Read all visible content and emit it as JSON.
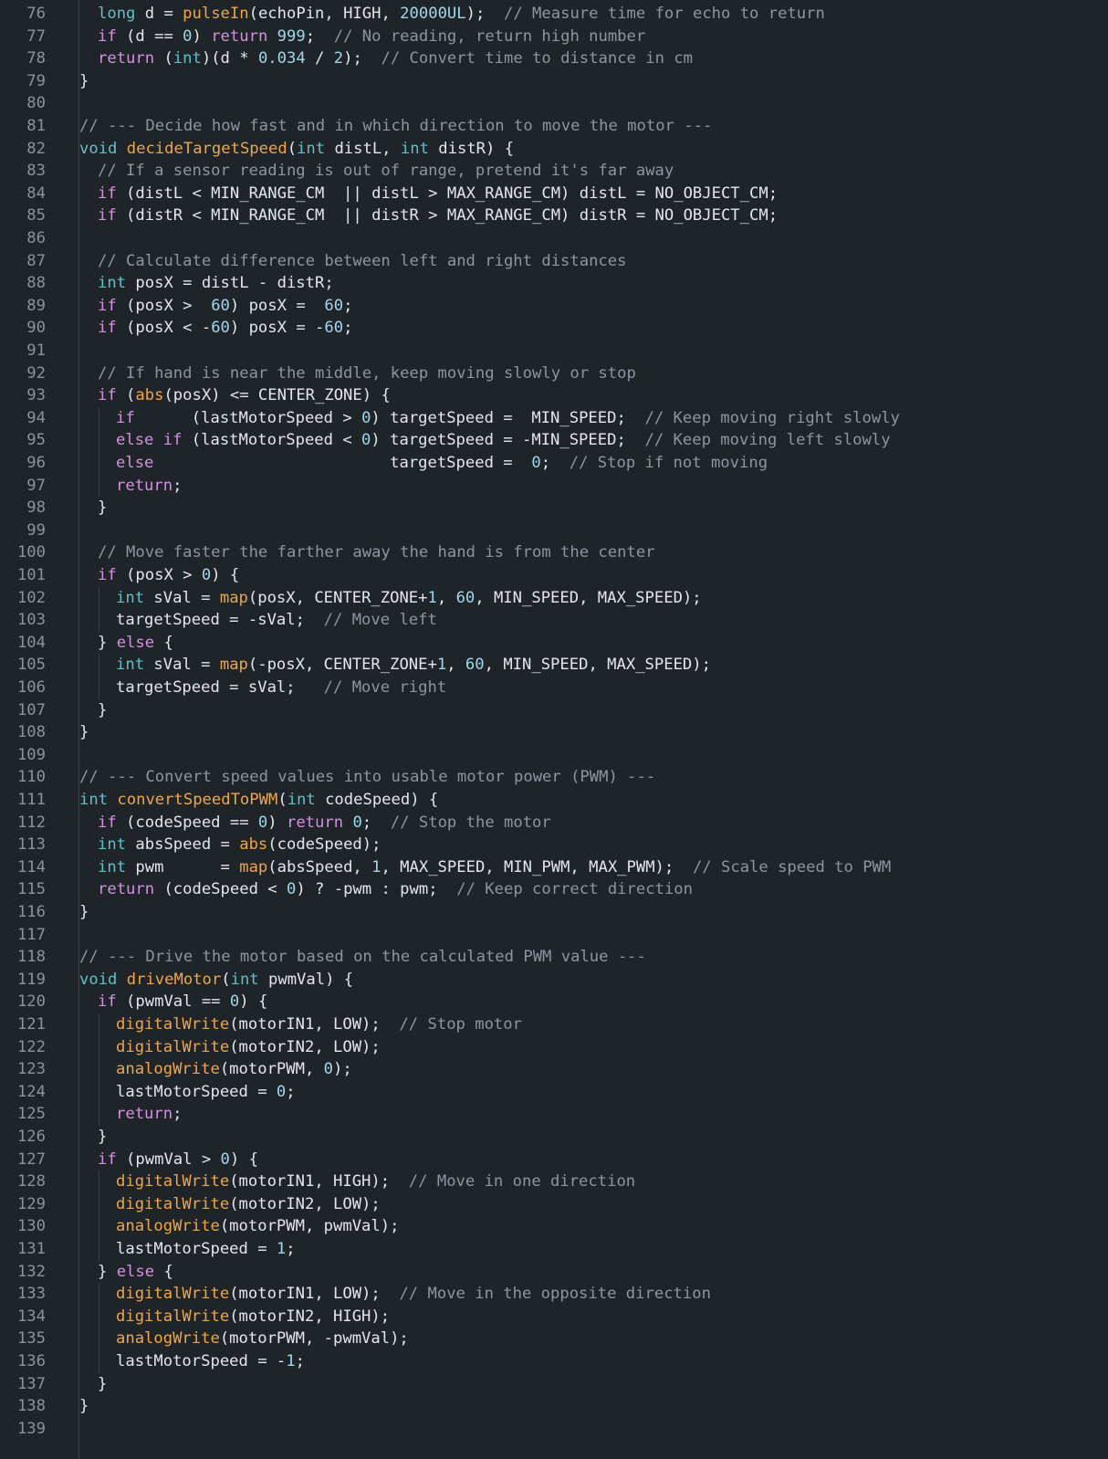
{
  "editor": {
    "first_line_number": 76,
    "lines": [
      {
        "indent": 1,
        "tokens": [
          [
            "t",
            "long"
          ],
          [
            "p",
            " d = "
          ],
          [
            "f",
            "pulseIn"
          ],
          [
            "p",
            "(echoPin, HIGH, "
          ],
          [
            "n",
            "20000UL"
          ],
          [
            "p",
            ");  "
          ],
          [
            "c",
            "// Measure time for echo to return"
          ]
        ]
      },
      {
        "indent": 1,
        "tokens": [
          [
            "k",
            "if"
          ],
          [
            "p",
            " (d == "
          ],
          [
            "n",
            "0"
          ],
          [
            "p",
            ") "
          ],
          [
            "k",
            "return"
          ],
          [
            "p",
            " "
          ],
          [
            "n",
            "999"
          ],
          [
            "p",
            ";  "
          ],
          [
            "c",
            "// No reading, return high number"
          ]
        ]
      },
      {
        "indent": 1,
        "tokens": [
          [
            "k",
            "return"
          ],
          [
            "p",
            " ("
          ],
          [
            "t",
            "int"
          ],
          [
            "p",
            ")(d * "
          ],
          [
            "n",
            "0.034"
          ],
          [
            "p",
            " / "
          ],
          [
            "n",
            "2"
          ],
          [
            "p",
            ");  "
          ],
          [
            "c",
            "// Convert time to distance in cm"
          ]
        ]
      },
      {
        "indent": 0,
        "tokens": [
          [
            "p",
            "}"
          ]
        ]
      },
      {
        "indent": 0,
        "tokens": []
      },
      {
        "indent": 0,
        "tokens": [
          [
            "c",
            "// --- Decide how fast and in which direction to move the motor ---"
          ]
        ]
      },
      {
        "indent": 0,
        "tokens": [
          [
            "t",
            "void"
          ],
          [
            "p",
            " "
          ],
          [
            "f",
            "decideTargetSpeed"
          ],
          [
            "p",
            "("
          ],
          [
            "t",
            "int"
          ],
          [
            "p",
            " distL, "
          ],
          [
            "t",
            "int"
          ],
          [
            "p",
            " distR) {"
          ]
        ]
      },
      {
        "indent": 1,
        "tokens": [
          [
            "c",
            "// If a sensor reading is out of range, pretend it's far away"
          ]
        ]
      },
      {
        "indent": 1,
        "tokens": [
          [
            "k",
            "if"
          ],
          [
            "p",
            " (distL < MIN_RANGE_CM  || distL > MAX_RANGE_CM) distL = NO_OBJECT_CM;"
          ]
        ]
      },
      {
        "indent": 1,
        "tokens": [
          [
            "k",
            "if"
          ],
          [
            "p",
            " (distR < MIN_RANGE_CM  || distR > MAX_RANGE_CM) distR = NO_OBJECT_CM;"
          ]
        ]
      },
      {
        "indent": 0,
        "tokens": []
      },
      {
        "indent": 1,
        "tokens": [
          [
            "c",
            "// Calculate difference between left and right distances"
          ]
        ]
      },
      {
        "indent": 1,
        "tokens": [
          [
            "t",
            "int"
          ],
          [
            "p",
            " posX = distL - distR;"
          ]
        ]
      },
      {
        "indent": 1,
        "tokens": [
          [
            "k",
            "if"
          ],
          [
            "p",
            " (posX >  "
          ],
          [
            "n",
            "60"
          ],
          [
            "p",
            ") posX =  "
          ],
          [
            "n",
            "60"
          ],
          [
            "p",
            ";"
          ]
        ]
      },
      {
        "indent": 1,
        "tokens": [
          [
            "k",
            "if"
          ],
          [
            "p",
            " (posX < -"
          ],
          [
            "n",
            "60"
          ],
          [
            "p",
            ") posX = -"
          ],
          [
            "n",
            "60"
          ],
          [
            "p",
            ";"
          ]
        ]
      },
      {
        "indent": 0,
        "tokens": []
      },
      {
        "indent": 1,
        "tokens": [
          [
            "c",
            "// If hand is near the middle, keep moving slowly or stop"
          ]
        ]
      },
      {
        "indent": 1,
        "tokens": [
          [
            "k",
            "if"
          ],
          [
            "p",
            " ("
          ],
          [
            "f",
            "abs"
          ],
          [
            "p",
            "(posX) <= CENTER_ZONE) {"
          ]
        ]
      },
      {
        "indent": 2,
        "tokens": [
          [
            "k",
            "if"
          ],
          [
            "p",
            "      (lastMotorSpeed > "
          ],
          [
            "n",
            "0"
          ],
          [
            "p",
            ") targetSpeed =  MIN_SPEED;  "
          ],
          [
            "c",
            "// Keep moving right slowly"
          ]
        ]
      },
      {
        "indent": 2,
        "tokens": [
          [
            "k",
            "else if"
          ],
          [
            "p",
            " (lastMotorSpeed < "
          ],
          [
            "n",
            "0"
          ],
          [
            "p",
            ") targetSpeed = -MIN_SPEED;  "
          ],
          [
            "c",
            "// Keep moving left slowly"
          ]
        ]
      },
      {
        "indent": 2,
        "tokens": [
          [
            "k",
            "else"
          ],
          [
            "p",
            "                         targetSpeed =  "
          ],
          [
            "n",
            "0"
          ],
          [
            "p",
            ";  "
          ],
          [
            "c",
            "// Stop if not moving"
          ]
        ]
      },
      {
        "indent": 2,
        "tokens": [
          [
            "k",
            "return"
          ],
          [
            "p",
            ";"
          ]
        ]
      },
      {
        "indent": 1,
        "tokens": [
          [
            "p",
            "}"
          ]
        ]
      },
      {
        "indent": 0,
        "tokens": []
      },
      {
        "indent": 1,
        "tokens": [
          [
            "c",
            "// Move faster the farther away the hand is from the center"
          ]
        ]
      },
      {
        "indent": 1,
        "tokens": [
          [
            "k",
            "if"
          ],
          [
            "p",
            " (posX > "
          ],
          [
            "n",
            "0"
          ],
          [
            "p",
            ") {"
          ]
        ]
      },
      {
        "indent": 2,
        "tokens": [
          [
            "t",
            "int"
          ],
          [
            "p",
            " sVal = "
          ],
          [
            "f",
            "map"
          ],
          [
            "p",
            "(posX, CENTER_ZONE+"
          ],
          [
            "n",
            "1"
          ],
          [
            "p",
            ", "
          ],
          [
            "n",
            "60"
          ],
          [
            "p",
            ", MIN_SPEED, MAX_SPEED);"
          ]
        ]
      },
      {
        "indent": 2,
        "tokens": [
          [
            "p",
            "targetSpeed = -sVal;  "
          ],
          [
            "c",
            "// Move left"
          ]
        ]
      },
      {
        "indent": 1,
        "tokens": [
          [
            "p",
            "} "
          ],
          [
            "k",
            "else"
          ],
          [
            "p",
            " {"
          ]
        ]
      },
      {
        "indent": 2,
        "tokens": [
          [
            "t",
            "int"
          ],
          [
            "p",
            " sVal = "
          ],
          [
            "f",
            "map"
          ],
          [
            "p",
            "(-posX, CENTER_ZONE+"
          ],
          [
            "n",
            "1"
          ],
          [
            "p",
            ", "
          ],
          [
            "n",
            "60"
          ],
          [
            "p",
            ", MIN_SPEED, MAX_SPEED);"
          ]
        ]
      },
      {
        "indent": 2,
        "tokens": [
          [
            "p",
            "targetSpeed = sVal;   "
          ],
          [
            "c",
            "// Move right"
          ]
        ]
      },
      {
        "indent": 1,
        "tokens": [
          [
            "p",
            "}"
          ]
        ]
      },
      {
        "indent": 0,
        "tokens": [
          [
            "p",
            "}"
          ]
        ]
      },
      {
        "indent": 0,
        "tokens": []
      },
      {
        "indent": 0,
        "tokens": [
          [
            "c",
            "// --- Convert speed values into usable motor power (PWM) ---"
          ]
        ]
      },
      {
        "indent": 0,
        "tokens": [
          [
            "t",
            "int"
          ],
          [
            "p",
            " "
          ],
          [
            "f",
            "convertSpeedToPWM"
          ],
          [
            "p",
            "("
          ],
          [
            "t",
            "int"
          ],
          [
            "p",
            " codeSpeed) {"
          ]
        ]
      },
      {
        "indent": 1,
        "tokens": [
          [
            "k",
            "if"
          ],
          [
            "p",
            " (codeSpeed == "
          ],
          [
            "n",
            "0"
          ],
          [
            "p",
            ") "
          ],
          [
            "k",
            "return"
          ],
          [
            "p",
            " "
          ],
          [
            "n",
            "0"
          ],
          [
            "p",
            ";  "
          ],
          [
            "c",
            "// Stop the motor"
          ]
        ]
      },
      {
        "indent": 1,
        "tokens": [
          [
            "t",
            "int"
          ],
          [
            "p",
            " absSpeed = "
          ],
          [
            "f",
            "abs"
          ],
          [
            "p",
            "(codeSpeed);"
          ]
        ]
      },
      {
        "indent": 1,
        "tokens": [
          [
            "t",
            "int"
          ],
          [
            "p",
            " pwm      = "
          ],
          [
            "f",
            "map"
          ],
          [
            "p",
            "(absSpeed, "
          ],
          [
            "n",
            "1"
          ],
          [
            "p",
            ", MAX_SPEED, MIN_PWM, MAX_PWM);  "
          ],
          [
            "c",
            "// Scale speed to PWM"
          ]
        ]
      },
      {
        "indent": 1,
        "tokens": [
          [
            "k",
            "return"
          ],
          [
            "p",
            " (codeSpeed < "
          ],
          [
            "n",
            "0"
          ],
          [
            "p",
            ") ? -pwm : pwm;  "
          ],
          [
            "c",
            "// Keep correct direction"
          ]
        ]
      },
      {
        "indent": 0,
        "tokens": [
          [
            "p",
            "}"
          ]
        ]
      },
      {
        "indent": 0,
        "tokens": []
      },
      {
        "indent": 0,
        "tokens": [
          [
            "c",
            "// --- Drive the motor based on the calculated PWM value ---"
          ]
        ]
      },
      {
        "indent": 0,
        "tokens": [
          [
            "t",
            "void"
          ],
          [
            "p",
            " "
          ],
          [
            "f",
            "driveMotor"
          ],
          [
            "p",
            "("
          ],
          [
            "t",
            "int"
          ],
          [
            "p",
            " pwmVal) {"
          ]
        ]
      },
      {
        "indent": 1,
        "tokens": [
          [
            "k",
            "if"
          ],
          [
            "p",
            " (pwmVal == "
          ],
          [
            "n",
            "0"
          ],
          [
            "p",
            ") {"
          ]
        ]
      },
      {
        "indent": 2,
        "tokens": [
          [
            "f",
            "digitalWrite"
          ],
          [
            "p",
            "(motorIN1, LOW);  "
          ],
          [
            "c",
            "// Stop motor"
          ]
        ]
      },
      {
        "indent": 2,
        "tokens": [
          [
            "f",
            "digitalWrite"
          ],
          [
            "p",
            "(motorIN2, LOW);"
          ]
        ]
      },
      {
        "indent": 2,
        "tokens": [
          [
            "f",
            "analogWrite"
          ],
          [
            "p",
            "(motorPWM, "
          ],
          [
            "n",
            "0"
          ],
          [
            "p",
            ");"
          ]
        ]
      },
      {
        "indent": 2,
        "tokens": [
          [
            "p",
            "lastMotorSpeed = "
          ],
          [
            "n",
            "0"
          ],
          [
            "p",
            ";"
          ]
        ]
      },
      {
        "indent": 2,
        "tokens": [
          [
            "k",
            "return"
          ],
          [
            "p",
            ";"
          ]
        ]
      },
      {
        "indent": 1,
        "tokens": [
          [
            "p",
            "}"
          ]
        ]
      },
      {
        "indent": 1,
        "tokens": [
          [
            "k",
            "if"
          ],
          [
            "p",
            " (pwmVal > "
          ],
          [
            "n",
            "0"
          ],
          [
            "p",
            ") {"
          ]
        ]
      },
      {
        "indent": 2,
        "tokens": [
          [
            "f",
            "digitalWrite"
          ],
          [
            "p",
            "(motorIN1, HIGH);  "
          ],
          [
            "c",
            "// Move in one direction"
          ]
        ]
      },
      {
        "indent": 2,
        "tokens": [
          [
            "f",
            "digitalWrite"
          ],
          [
            "p",
            "(motorIN2, LOW);"
          ]
        ]
      },
      {
        "indent": 2,
        "tokens": [
          [
            "f",
            "analogWrite"
          ],
          [
            "p",
            "(motorPWM, pwmVal);"
          ]
        ]
      },
      {
        "indent": 2,
        "tokens": [
          [
            "p",
            "lastMotorSpeed = "
          ],
          [
            "n",
            "1"
          ],
          [
            "p",
            ";"
          ]
        ]
      },
      {
        "indent": 1,
        "tokens": [
          [
            "p",
            "} "
          ],
          [
            "k",
            "else"
          ],
          [
            "p",
            " {"
          ]
        ]
      },
      {
        "indent": 2,
        "tokens": [
          [
            "f",
            "digitalWrite"
          ],
          [
            "p",
            "(motorIN1, LOW);  "
          ],
          [
            "c",
            "// Move in the opposite direction"
          ]
        ]
      },
      {
        "indent": 2,
        "tokens": [
          [
            "f",
            "digitalWrite"
          ],
          [
            "p",
            "(motorIN2, HIGH);"
          ]
        ]
      },
      {
        "indent": 2,
        "tokens": [
          [
            "f",
            "analogWrite"
          ],
          [
            "p",
            "(motorPWM, -pwmVal);"
          ]
        ]
      },
      {
        "indent": 2,
        "tokens": [
          [
            "p",
            "lastMotorSpeed = -"
          ],
          [
            "n",
            "1"
          ],
          [
            "p",
            ";"
          ]
        ]
      },
      {
        "indent": 1,
        "tokens": [
          [
            "p",
            "}"
          ]
        ]
      },
      {
        "indent": 0,
        "tokens": [
          [
            "p",
            "}"
          ]
        ]
      },
      {
        "indent": 0,
        "tokens": []
      }
    ]
  },
  "theme": {
    "background": "#1f2429",
    "text": "#e3e7ec",
    "line_number": "#8a939c",
    "comment": "#8c96a1",
    "keyword": "#d291e0",
    "type": "#5cc2c8",
    "function": "#efa64a",
    "number": "#9fd8ea",
    "guide": "#3a4048"
  }
}
